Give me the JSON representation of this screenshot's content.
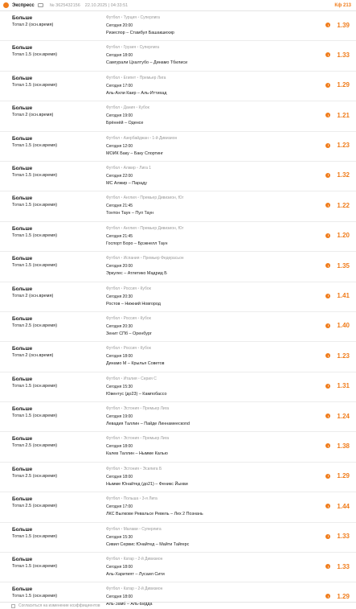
{
  "header": {
    "title": "Экспресс",
    "ticket_no": "№ 3625432156",
    "datetime": "22.10.2025 | 04:33:51",
    "coef": "Кф 213"
  },
  "bets": [
    {
      "title": "Больше",
      "type": "Тотал 2 (осн.время)",
      "sport": "Футбол",
      "country": "Турция",
      "league": "Суперлига",
      "time": "Сегодня 20:00",
      "teams": "Ризеспор – Стамбул Башакшехир",
      "odds": "1.39"
    },
    {
      "title": "Больше",
      "type": "Тотал 1.5 (осн.время)",
      "sport": "Футбол",
      "country": "Грузия",
      "league": "Суперлига",
      "time": "Сегодня 18:00",
      "teams": "Самгурали Цхалтубо – Динамо Тбилиси",
      "odds": "1.33"
    },
    {
      "title": "Больше",
      "type": "Тотал 1.5 (осн.время)",
      "sport": "Футбол",
      "country": "Египет",
      "league": "Премьер Лига",
      "time": "Сегодня 17:00",
      "teams": "Аль-Ахли Каир – Аль-Иттихад",
      "odds": "1.29"
    },
    {
      "title": "Больше",
      "type": "Тотал 2 (осн.время)",
      "sport": "Футбол",
      "country": "Дания",
      "league": "Кубок",
      "time": "Сегодня 19:00",
      "teams": "Брённёй – Оденсе",
      "odds": "1.21"
    },
    {
      "title": "Больше",
      "type": "Тотал 1.5 (осн.время)",
      "sport": "Футбол",
      "country": "Азербайджан",
      "league": "1-й Дивизион",
      "time": "Сегодня 12:00",
      "teams": "МОИК Баку – Баку Спортинг",
      "odds": "1.23"
    },
    {
      "title": "Больше",
      "type": "Тотал 1.5 (осн.время)",
      "sport": "Футбол",
      "country": "Алжир",
      "league": "Лига 1",
      "time": "Сегодня 22:00",
      "teams": "МС Алжир – Парадy",
      "odds": "1.32"
    },
    {
      "title": "Больше",
      "type": "Тотал 1.5 (осн.время)",
      "sport": "Футбол",
      "country": "Англия",
      "league": "Премьер Дивизион, Юг",
      "time": "Сегодня 21:45",
      "teams": "Тонтон Таун – Пул Таун",
      "odds": "1.22"
    },
    {
      "title": "Больше",
      "type": "Тотал 1.5 (осн.время)",
      "sport": "Футбол",
      "country": "Англия",
      "league": "Премьер Дивизион, Юг",
      "time": "Сегодня 21:45",
      "teams": "Госпорт Боро – Брэкнелл Таун",
      "odds": "1.20"
    },
    {
      "title": "Больше",
      "type": "Тотал 1.5 (осн.время)",
      "sport": "Футбол",
      "country": "Испания",
      "league": "Премьер Федерасьон",
      "time": "Сегодня 20:00",
      "teams": "Эркулес – Атлетико Мадрид Б",
      "odds": "1.35"
    },
    {
      "title": "Больше",
      "type": "Тотал 2 (осн.время)",
      "sport": "Футбол",
      "country": "Россия",
      "league": "Кубок",
      "time": "Сегодня 20:30",
      "teams": "Ростов – Нижний Новгород",
      "odds": "1.41"
    },
    {
      "title": "Больше",
      "type": "Тотал 2.5 (осн.время)",
      "sport": "Футбол",
      "country": "Россия",
      "league": "Кубок",
      "time": "Сегодня 20:30",
      "teams": "Зенит СПб – Оренбург",
      "odds": "1.40"
    },
    {
      "title": "Больше",
      "type": "Тотал 2 (осн.время)",
      "sport": "Футбол",
      "country": "Россия",
      "league": "Кубок",
      "time": "Сегодня 18:00",
      "teams": "Динамо М – Крылья Советов",
      "odds": "1.23"
    },
    {
      "title": "Больше",
      "type": "Тотал 1.5 (осн.время)",
      "sport": "Футбол",
      "country": "Италия",
      "league": "Серия С",
      "time": "Сегодня 15:30",
      "teams": "Ювентус (до23) – Кампобассо",
      "odds": "1.31"
    },
    {
      "title": "Больше",
      "type": "Тотал 1.5 (осн.время)",
      "sport": "Футбол",
      "country": "Эстония",
      "league": "Премьер Лига",
      "time": "Сегодня 19:00",
      "teams": "Левадия Таллин – Пайде Линнамеескond",
      "odds": "1.24"
    },
    {
      "title": "Больше",
      "type": "Тотал 2.5 (осн.время)",
      "sport": "Футбол",
      "country": "Эстония",
      "league": "Премьер Лига",
      "time": "Сегодня 18:00",
      "teams": "Калев Таллин – Нымме Калью",
      "odds": "1.38"
    },
    {
      "title": "Больше",
      "type": "Тотал 2.5 (осн.время)",
      "sport": "Футбол",
      "country": "Эстония",
      "league": "Эсилига Б",
      "time": "Сегодня 18:00",
      "teams": "Нымме Юнайтед (до21) – Феникс Йыхви",
      "odds": "1.29"
    },
    {
      "title": "Больше",
      "type": "Тотал 2.5 (осн.время)",
      "sport": "Футбол",
      "country": "Польша",
      "league": "3-я Лига",
      "time": "Сегодня 17:00",
      "teams": "ЛКС Вылкове Ревальсе Ревель – Лех 2 Познань",
      "odds": "1.44"
    },
    {
      "title": "Больше",
      "type": "Тотал 1.5 (осн.время)",
      "sport": "Футбол",
      "country": "Малави",
      "league": "Суперлига",
      "time": "Сегодня 15:30",
      "teams": "Сивил Сервис Юнайтед – Майти Тайгерс",
      "odds": "1.33"
    },
    {
      "title": "Больше",
      "type": "Тотал 1.5 (осн.время)",
      "sport": "Футбол",
      "country": "Катар",
      "league": "2-й Дивизион",
      "time": "Сегодня 18:00",
      "teams": "Аль-Харитият – Лусаил Сити",
      "odds": "1.33"
    },
    {
      "title": "Больше",
      "type": "Тотал 1.5 (осн.время)",
      "sport": "Футбол",
      "country": "Катар",
      "league": "2-й Дивизион",
      "time": "Сегодня 18:00",
      "teams": "Аль-Замб – Аль-Бидда",
      "odds": "1.29"
    }
  ],
  "footer": {
    "text": "Согласиться на изменение коэффициентов"
  },
  "colors": {
    "accent": "#f07c1b",
    "muted": "#9a9a9a",
    "text": "#1a1a1a"
  }
}
